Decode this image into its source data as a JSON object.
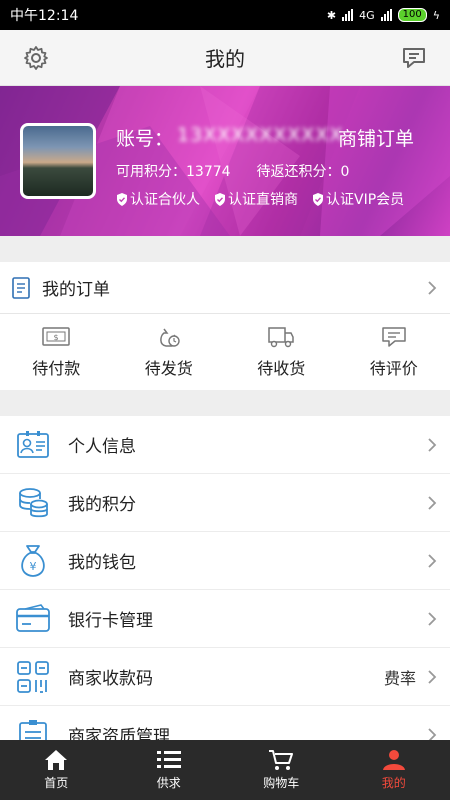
{
  "status_bar": {
    "time": "中午12:14",
    "battery": "100",
    "network": "4G"
  },
  "header": {
    "title": "我的"
  },
  "profile": {
    "account_label": "账号：",
    "account_value": "13XXXXXXXXXX",
    "shop_order": "商铺订单",
    "points_available": "可用积分：13774",
    "points_pending": "待返还积分：0",
    "badges": [
      "认证合伙人",
      "认证直销商",
      "认证VIP会员"
    ]
  },
  "orders": {
    "title": "我的订单",
    "tabs": [
      {
        "label": "待付款",
        "icon": "payment-icon"
      },
      {
        "label": "待发货",
        "icon": "shipping-bag-icon"
      },
      {
        "label": "待收货",
        "icon": "delivery-truck-icon"
      },
      {
        "label": "待评价",
        "icon": "review-chat-icon"
      }
    ]
  },
  "menu": [
    {
      "label": "个人信息",
      "icon": "id-card-icon",
      "extra": ""
    },
    {
      "label": "我的积分",
      "icon": "coins-stack-icon",
      "extra": ""
    },
    {
      "label": "我的钱包",
      "icon": "money-bag-icon",
      "extra": ""
    },
    {
      "label": "银行卡管理",
      "icon": "bank-card-icon",
      "extra": ""
    },
    {
      "label": "商家收款码",
      "icon": "qr-code-icon",
      "extra": "费率"
    },
    {
      "label": "商家资质管理",
      "icon": "certificate-icon",
      "extra": ""
    }
  ],
  "bottom_nav": [
    {
      "label": "首页",
      "icon": "home-icon",
      "active": false
    },
    {
      "label": "供求",
      "icon": "list-icon",
      "active": false
    },
    {
      "label": "购物车",
      "icon": "cart-icon",
      "active": false
    },
    {
      "label": "我的",
      "icon": "person-icon",
      "active": true
    }
  ],
  "colors": {
    "accent": "#f24a3c",
    "icon_blue": "#3a8fd1",
    "banner_magenta": "#d048c0"
  }
}
